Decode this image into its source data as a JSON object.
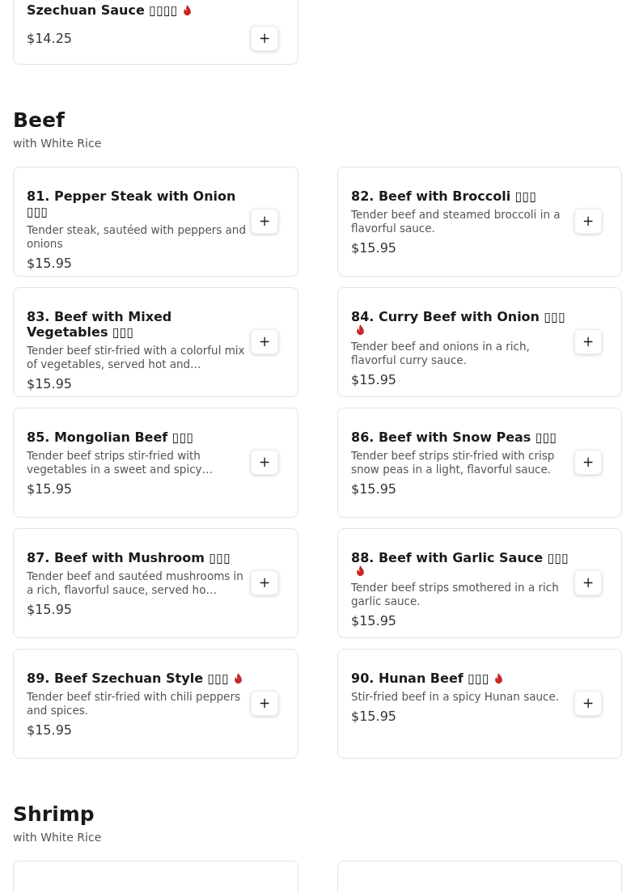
{
  "top_item": {
    "name": "Szechuan Sauce ▯▯▯▯",
    "spicy": true,
    "price": "$14.25",
    "add": "+"
  },
  "sections": [
    {
      "title": "Beef",
      "subtitle": "with White Rice",
      "items": [
        {
          "name": "81. Pepper Steak with Onion ▯▯▯",
          "spicy": false,
          "description": "Tender steak, sautéed with peppers and onions",
          "price": "$15.95",
          "add": "+"
        },
        {
          "name": "82. Beef with Broccoli ▯▯▯",
          "spicy": false,
          "description": "Tender beef and steamed broccoli in a flavorful sauce.",
          "price": "$15.95",
          "add": "+"
        },
        {
          "name": "83. Beef with Mixed Vegetables ▯▯▯",
          "spicy": false,
          "description": "Tender beef stir-fried with a colorful mix of vegetables, served hot and…",
          "price": "$15.95",
          "add": "+"
        },
        {
          "name": "84. Curry Beef with Onion ▯▯▯",
          "spicy": true,
          "description": "Tender beef and onions in a rich, flavorful curry sauce.",
          "price": "$15.95",
          "add": "+"
        },
        {
          "name": "85. Mongolian Beef ▯▯▯",
          "spicy": false,
          "description": "Tender beef strips stir-fried with vegetables in a sweet and spicy…",
          "price": "$15.95",
          "add": "+"
        },
        {
          "name": "86. Beef with Snow Peas ▯▯▯",
          "spicy": false,
          "description": "Tender beef strips stir-fried with crisp snow peas in a light, flavorful sauce.",
          "price": "$15.95",
          "add": "+"
        },
        {
          "name": "87. Beef with Mushroom ▯▯▯",
          "spicy": false,
          "description": "Tender beef and sautéed mushrooms in a rich, flavorful sauce, served ho…",
          "price": "$15.95",
          "add": "+"
        },
        {
          "name": "88. Beef with Garlic Sauce ▯▯▯",
          "spicy": true,
          "description": "Tender beef strips smothered in a rich garlic sauce.",
          "price": "$15.95",
          "add": "+"
        },
        {
          "name": "89. Beef Szechuan Style ▯▯▯",
          "spicy": true,
          "description": "Tender beef stir-fried with chili peppers and spices.",
          "price": "$15.95",
          "add": "+"
        },
        {
          "name": "90. Hunan Beef ▯▯▯",
          "spicy": true,
          "description": "Stir-fried beef in a spicy Hunan sauce.",
          "price": "$15.95",
          "add": "+"
        }
      ]
    },
    {
      "title": "Shrimp",
      "subtitle": "with White Rice"
    }
  ]
}
